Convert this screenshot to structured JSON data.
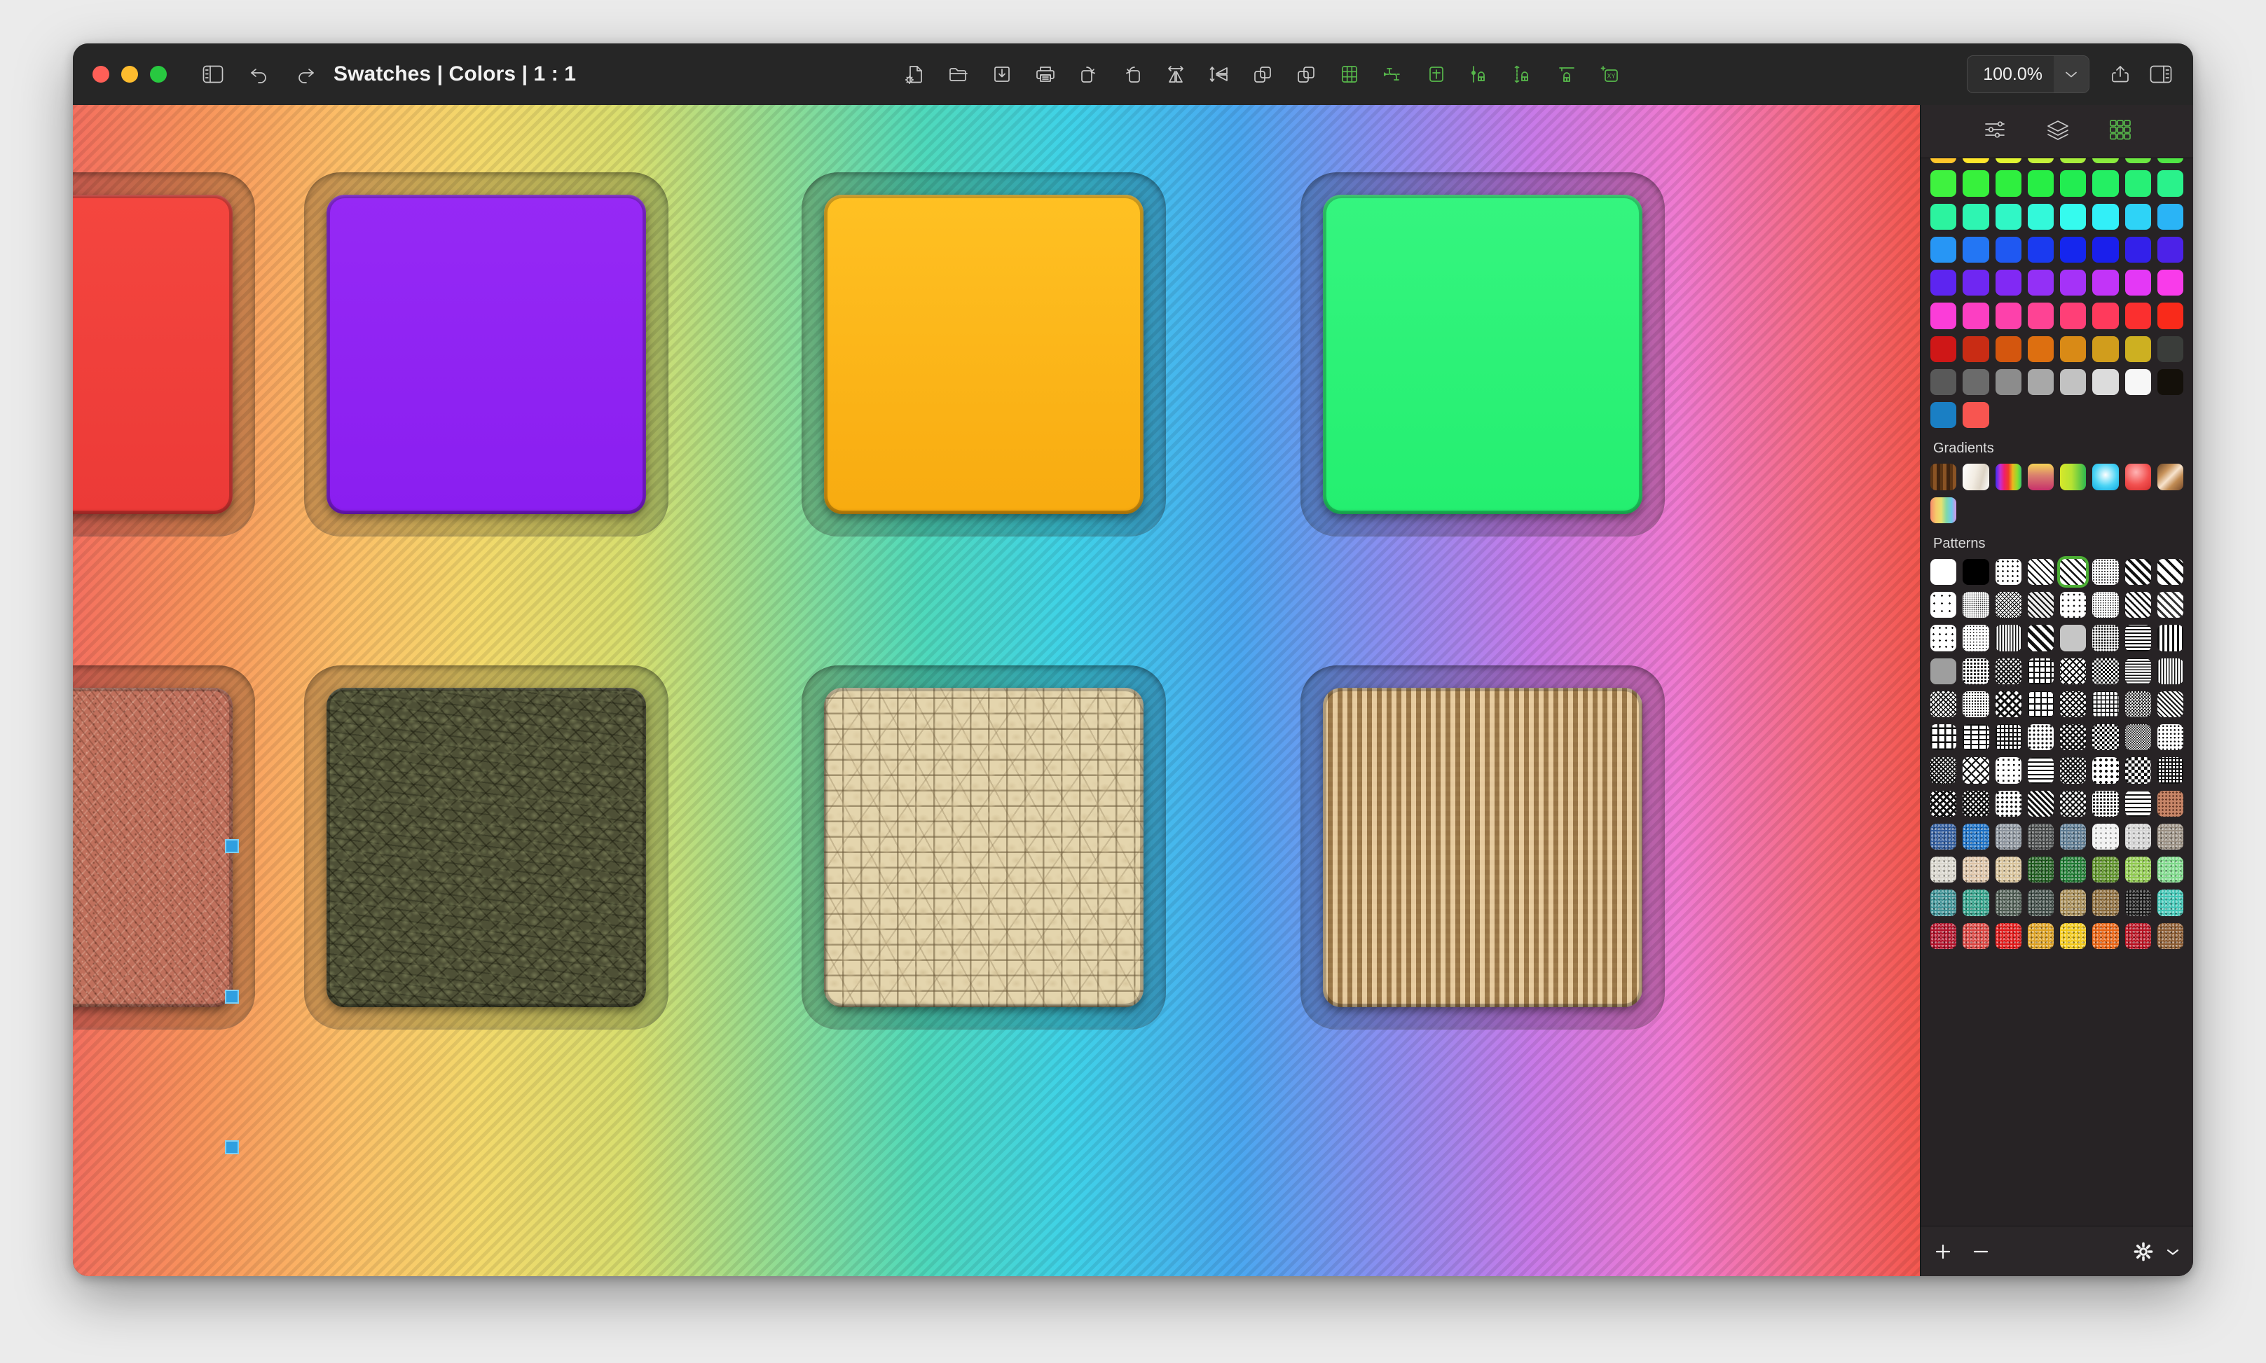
{
  "window": {
    "title": "Swatches | Colors | 1 : 1",
    "traffic_lights": [
      {
        "name": "close",
        "color": "#ff5f57"
      },
      {
        "name": "minimize",
        "color": "#febc2e"
      },
      {
        "name": "zoom",
        "color": "#28c840"
      }
    ]
  },
  "toolbar": {
    "left_icons": [
      {
        "name": "sidebar-toggle-icon",
        "label": "Toggle Sidebar"
      },
      {
        "name": "undo-icon",
        "label": "Undo"
      },
      {
        "name": "redo-icon",
        "label": "Redo"
      }
    ],
    "center_icons": [
      {
        "name": "new-document-icon",
        "label": "New Document"
      },
      {
        "name": "open-folder-icon",
        "label": "Open"
      },
      {
        "name": "save-download-icon",
        "label": "Save"
      },
      {
        "name": "print-icon",
        "label": "Print"
      },
      {
        "name": "rotate-left-icon",
        "label": "Rotate Left"
      },
      {
        "name": "rotate-right-icon",
        "label": "Rotate Right"
      },
      {
        "name": "flip-horizontal-icon",
        "label": "Flip Horizontal"
      },
      {
        "name": "flip-vertical-icon",
        "label": "Flip Vertical"
      },
      {
        "name": "bring-forward-icon",
        "label": "Bring Forward"
      },
      {
        "name": "send-backward-icon",
        "label": "Send Backward"
      },
      {
        "name": "grid-icon",
        "label": "Show Grid"
      },
      {
        "name": "snap-spacing-icon",
        "label": "Snap Spacing"
      },
      {
        "name": "snap-bounds-icon",
        "label": "Snap to Bounds"
      },
      {
        "name": "snap-left-icon",
        "label": "Snap Left"
      },
      {
        "name": "snap-vertical-icon",
        "label": "Snap Vertical"
      },
      {
        "name": "snap-top-icon",
        "label": "Snap Top"
      },
      {
        "name": "coordinates-xy-icon",
        "label": "XY"
      }
    ],
    "zoom_value": "100.0%",
    "right_icons": [
      {
        "name": "zoom-dropdown-chevron-icon",
        "label": "Zoom presets"
      },
      {
        "name": "share-icon",
        "label": "Share"
      },
      {
        "name": "right-panel-toggle-icon",
        "label": "Toggle Inspector"
      }
    ]
  },
  "panel": {
    "tabs": [
      {
        "name": "tab-adjustments",
        "label": "Adjustments",
        "active": false
      },
      {
        "name": "tab-layers",
        "label": "Layers",
        "active": false
      },
      {
        "name": "tab-swatches",
        "label": "Swatches",
        "active": true
      }
    ],
    "sections": {
      "colors_label": "",
      "gradients_label": "Gradients",
      "patterns_label": "Patterns"
    },
    "footer": [
      {
        "name": "add-swatch-button",
        "label": "+"
      },
      {
        "name": "remove-swatch-button",
        "label": "−"
      },
      {
        "name": "swatch-options-gear-button",
        "label": "Options"
      },
      {
        "name": "swatch-options-chevron-icon",
        "label": "More"
      }
    ]
  },
  "colors": [
    [
      "#ffc52b",
      "#ffe62b",
      "#e2f531",
      "#c6f23a",
      "#a8ef3c",
      "#8aec3e",
      "#6ce942",
      "#4fe645"
    ],
    [
      "#3ff23f",
      "#37f13c",
      "#2fef3f",
      "#27ee45",
      "#22ed51",
      "#24ef63",
      "#27f076",
      "#2af28b"
    ],
    [
      "#2cf39f",
      "#2ef5b2",
      "#30f7c6",
      "#33f9da",
      "#35fbee",
      "#32eff8",
      "#2ed3f7",
      "#2ab4f6"
    ],
    [
      "#2796f5",
      "#2376f4",
      "#1f58f2",
      "#1a3af0",
      "#1526ee",
      "#1a1fec",
      "#3320ea",
      "#4c22e8"
    ],
    [
      "#5d25f0",
      "#6f27f2",
      "#8129f4",
      "#9330f6",
      "#a532f8",
      "#c234f8",
      "#e438f6",
      "#f93bea"
    ],
    [
      "#fb3dd8",
      "#fc3fc2",
      "#fd41ab",
      "#fe4394",
      "#ff3f77",
      "#ff3a5c",
      "#fb2f2f",
      "#f92a1a"
    ],
    [
      "#cf1717",
      "#c92c14",
      "#d4560e",
      "#dd6f10",
      "#d98a16",
      "#d19d1c",
      "#cdb021",
      "#3a3d3a"
    ],
    [
      "#595959",
      "#6b6b6b",
      "#8c8c8c",
      "#a8a8a8",
      "#c2c2c2",
      "#dcdcdc",
      "#f7f7f7",
      "#14100a"
    ],
    [
      "#1a7fc4",
      "#f85550"
    ]
  ],
  "gradients": [
    {
      "name": "gradient-brown-stripe",
      "css": "repeating-linear-gradient(90deg,#5a3414 0 4px,#8a5324 4px 9px,#3e2310 9px 14px)"
    },
    {
      "name": "gradient-pearl-white",
      "css": "linear-gradient(105deg,#ffffff 0%,#f2ece2 45%,#ddd4c6 70%,#ffffff 100%)"
    },
    {
      "name": "gradient-rainbow-vertical-bars",
      "css": "linear-gradient(90deg,#3b2df0 0%,#c22fd8 18%,#f01f6a 34%,#ef3a2a 50%,#ebb81e 66%,#8fdc2e 84%,#35c96a 100%)"
    },
    {
      "name": "gradient-sunset-gold-magenta",
      "css": "linear-gradient(180deg,#f5d458 0%,#d97e6e 45%,#c8306b 100%)"
    },
    {
      "name": "gradient-lime-green",
      "css": "linear-gradient(90deg,#d7e82a 0%,#b6e233 45%,#2eb84e 100%)"
    },
    {
      "name": "gradient-radial-cyan",
      "css": "radial-gradient(circle at 50% 42%,#ffffff 0%,#4bd4f5 55%,#0fa9e2 100%)"
    },
    {
      "name": "gradient-radial-red",
      "css": "radial-gradient(circle at 42% 32%,#ffb4b4 0%,#f2504f 55%,#d42c2c 100%)"
    },
    {
      "name": "gradient-copper-metal",
      "css": "linear-gradient(135deg,#6b4424 0%,#c9945c 30%,#f7e3cd 50%,#c08a52 70%,#74492a 100%)"
    },
    {
      "name": "gradient-pastel-rainbow",
      "css": "linear-gradient(90deg,#f88a6a 0%,#f6c96a 22%,#e8e06e 42%,#7fd9a8 62%,#6fc8ec 82%,#d794e8 100%)"
    }
  ],
  "patterns_mono": [
    {
      "name": "pattern-solid-white",
      "selected": false
    },
    {
      "name": "pattern-solid-black",
      "selected": false
    },
    {
      "name": "pattern-dots-sparse",
      "selected": false
    },
    {
      "name": "pattern-diagonal-thin",
      "selected": false
    },
    {
      "name": "pattern-diagonal-selected",
      "selected": true
    },
    {
      "name": "pattern-dots-fine",
      "selected": false
    },
    {
      "name": "pattern-diagonal-bold",
      "selected": false
    },
    {
      "name": "pattern-diagonal-wide",
      "selected": false
    },
    {
      "name": "pattern-dots-scatter",
      "selected": false
    },
    {
      "name": "pattern-noise-fine",
      "selected": false
    },
    {
      "name": "pattern-crosshatch-fine",
      "selected": false
    },
    {
      "name": "pattern-diagonal-dash",
      "selected": false
    },
    {
      "name": "pattern-grid-dots",
      "selected": false
    },
    {
      "name": "pattern-noise-dense",
      "selected": false
    },
    {
      "name": "pattern-diagonal-medium",
      "selected": false
    },
    {
      "name": "pattern-diagonal-soft",
      "selected": false
    },
    {
      "name": "pattern-dots-grid-wide",
      "selected": false
    },
    {
      "name": "pattern-speckle",
      "selected": false
    },
    {
      "name": "pattern-stripes-vertical-thin",
      "selected": false
    },
    {
      "name": "pattern-diagonal-thick",
      "selected": false
    },
    {
      "name": "pattern-solid-gray",
      "selected": false
    },
    {
      "name": "pattern-noise-coarse",
      "selected": false
    },
    {
      "name": "pattern-horizontal-lines",
      "selected": false
    },
    {
      "name": "pattern-vertical-bars",
      "selected": false
    },
    {
      "name": "pattern-solid-gray-dark",
      "selected": false
    },
    {
      "name": "pattern-dots-dense",
      "selected": false
    },
    {
      "name": "pattern-weave-diag",
      "selected": false
    },
    {
      "name": "pattern-brick-grid",
      "selected": false
    },
    {
      "name": "pattern-diagonal-cross",
      "selected": false
    },
    {
      "name": "pattern-checker-small",
      "selected": false
    },
    {
      "name": "pattern-horizontal-dense",
      "selected": false
    },
    {
      "name": "pattern-vertical-dense",
      "selected": false
    },
    {
      "name": "pattern-weave-dense",
      "selected": false
    },
    {
      "name": "pattern-noise-mid",
      "selected": false
    },
    {
      "name": "pattern-weave-cross",
      "selected": false
    },
    {
      "name": "pattern-grid-lines",
      "selected": false
    },
    {
      "name": "pattern-diagonal-cross2",
      "selected": false
    },
    {
      "name": "pattern-grid-fine",
      "selected": false
    },
    {
      "name": "pattern-checker-tiny",
      "selected": false
    },
    {
      "name": "pattern-zigzag",
      "selected": false
    },
    {
      "name": "pattern-grid-bold",
      "selected": false
    },
    {
      "name": "pattern-grid-offset",
      "selected": false
    },
    {
      "name": "pattern-grid-double",
      "selected": false
    },
    {
      "name": "pattern-halftone",
      "selected": false
    },
    {
      "name": "pattern-crosshatch-bold",
      "selected": false
    },
    {
      "name": "pattern-checkerboard",
      "selected": false
    },
    {
      "name": "pattern-checker-dense",
      "selected": false
    },
    {
      "name": "pattern-diagonal-dotted",
      "selected": false
    },
    {
      "name": "pattern-weave-tight",
      "selected": false
    },
    {
      "name": "pattern-diagonal-grid",
      "selected": false
    },
    {
      "name": "pattern-dots-offset",
      "selected": false
    },
    {
      "name": "pattern-wave-lines",
      "selected": false
    },
    {
      "name": "pattern-cross-dense",
      "selected": false
    },
    {
      "name": "pattern-dots-large",
      "selected": false
    },
    {
      "name": "pattern-checker-wide",
      "selected": false
    },
    {
      "name": "pattern-grid-mesh",
      "selected": false
    },
    {
      "name": "pattern-basket-weave",
      "selected": false
    },
    {
      "name": "pattern-herringbone",
      "selected": false
    },
    {
      "name": "pattern-scales",
      "selected": false
    },
    {
      "name": "pattern-chevron",
      "selected": false
    },
    {
      "name": "pattern-diamond-grid",
      "selected": false
    },
    {
      "name": "pattern-dots-ring",
      "selected": false
    },
    {
      "name": "pattern-wavy",
      "selected": false
    },
    {
      "name": "pattern-terracotta-noise",
      "selected": false
    }
  ],
  "patterns_color": [
    "#2f5a9b",
    "#1a6fc4",
    "#8b939c",
    "#474a4a",
    "#5c7a91",
    "#f0f0f0",
    "#d4d4d4",
    "#9a8f82",
    "#d8d5cc",
    "#ddc3a6",
    "#d8c39a",
    "#1d5a1d",
    "#1e7a32",
    "#5b8f26",
    "#8fc94e",
    "#7ed98a",
    "#3b8f93",
    "#2f9e86",
    "#4e5c52",
    "#3d4a45",
    "#a48a54",
    "#8a6a3a",
    "#181818",
    "#3fc4b4",
    "#b01028",
    "#d9433f",
    "#e01818",
    "#dca020",
    "#f0c818",
    "#e8610f",
    "#b81020",
    "#8a5a30"
  ]
}
